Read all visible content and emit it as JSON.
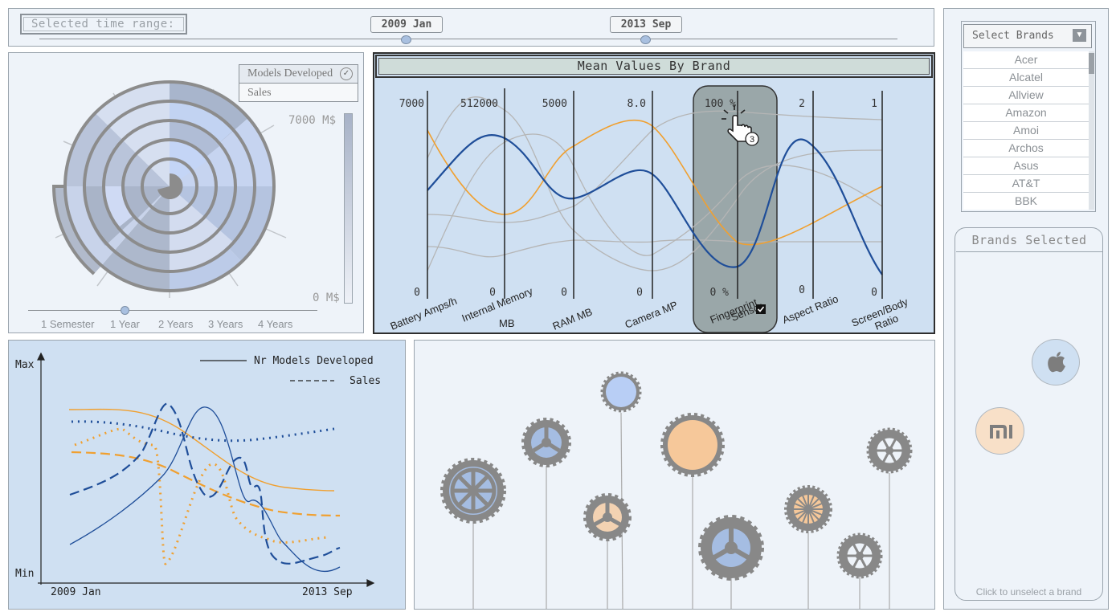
{
  "time_range": {
    "label": "Selected time range:",
    "start": "2009 Jan",
    "end": "2013 Sep"
  },
  "spiral": {
    "toggle": {
      "models": "Models Developed",
      "sales": "Sales"
    },
    "legend_max": "7000 M$",
    "legend_min": "0 M$",
    "periods": [
      "1 Semester",
      "1 Year",
      "2 Years",
      "3 Years",
      "4 Years"
    ],
    "selected_period": "1 Year"
  },
  "parallel_coords": {
    "title": "Mean Values By Brand",
    "axes": [
      {
        "name": "Battery Amps/h",
        "max": "7000",
        "min": "0"
      },
      {
        "name": "Internal Memory MB",
        "max": "512000",
        "min": "0"
      },
      {
        "name": "RAM MB",
        "max": "5000",
        "min": "0"
      },
      {
        "name": "Camera MP",
        "max": "8.0",
        "min": "0"
      },
      {
        "name": "Fingerprint Sensor",
        "max": "100 %",
        "min": "0 %"
      },
      {
        "name": "Aspect Ratio",
        "max": "2",
        "min": "0"
      },
      {
        "name": "Screen/Body Ratio",
        "max": "1",
        "min": "0"
      }
    ],
    "highlighted_axis": "Fingerprint Sensor",
    "cursor_count": "3",
    "colors": {
      "apple": "#1f4e99",
      "xiaomi": "#f0a030",
      "other": "#b5b5b5"
    }
  },
  "timeline": {
    "legend": {
      "models": "Nr Models Developed",
      "sales": "Sales"
    },
    "y_max": "Max",
    "y_min": "Min",
    "x_start": "2009 Jan",
    "x_end": "2013 Sep"
  },
  "brands": {
    "select_label": "Select Brands",
    "list": [
      "Acer",
      "Alcatel",
      "Allview",
      "Amazon",
      "Amoi",
      "Archos",
      "Asus",
      "AT&T",
      "BBK"
    ],
    "selected_title": "Brands Selected",
    "selected": [
      "Apple",
      "Xiaomi"
    ],
    "hint": "Click to unselect a brand"
  }
}
